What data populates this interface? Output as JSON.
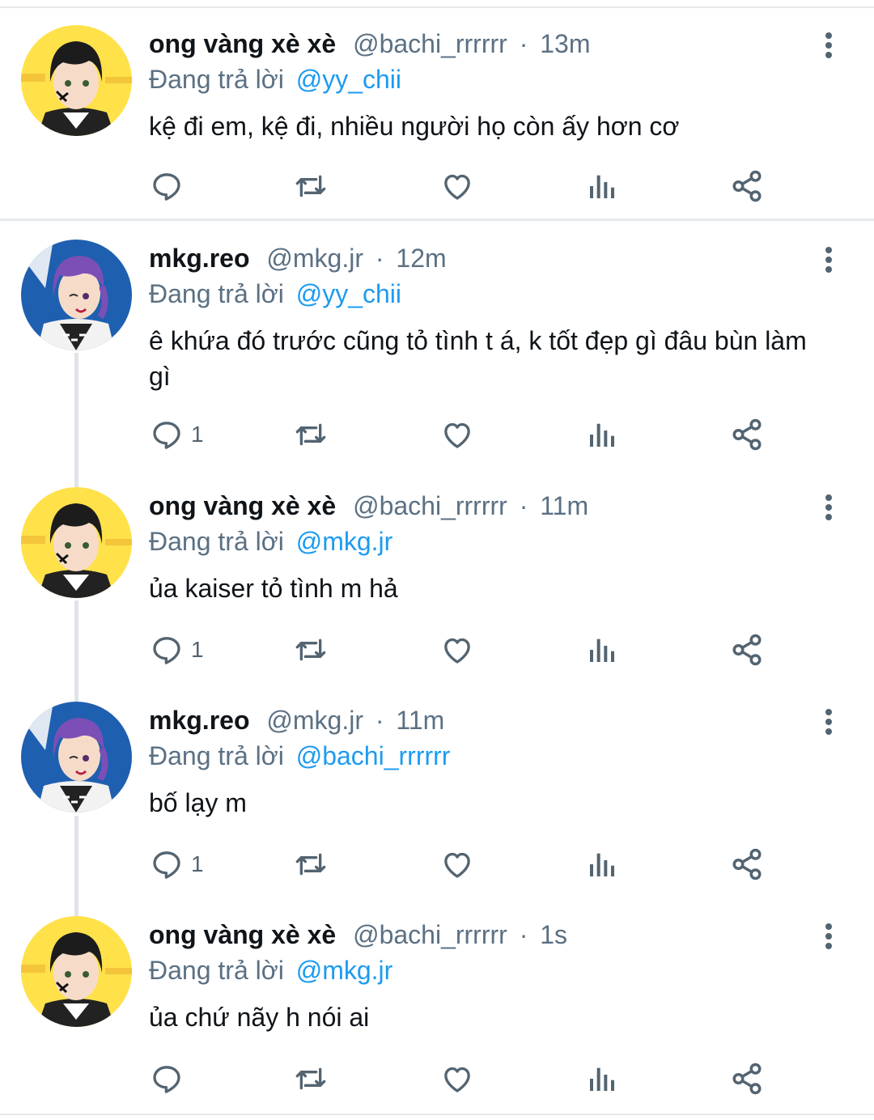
{
  "tweets": [
    {
      "name": "ong vàng xè xè",
      "handle": "@bachi_rrrrrr",
      "separator": "·",
      "time": "13m",
      "replying_label": "Đang trả lời",
      "replying_to": "@yy_chii",
      "text": "kệ đi em, kệ đi, nhiều người họ còn ấy hơn cơ",
      "reply_count": "",
      "avatar": "yellow-avatar"
    },
    {
      "name": "mkg.reo",
      "handle": "@mkg.jr",
      "separator": "·",
      "time": "12m",
      "replying_label": "Đang trả lời",
      "replying_to": "@yy_chii",
      "text": "ê khứa đó trước cũng tỏ tình t á, k tốt đẹp gì đâu bùn làm gì",
      "reply_count": "1",
      "avatar": "blue-avatar"
    },
    {
      "name": "ong vàng xè xè",
      "handle": "@bachi_rrrrrr",
      "separator": "·",
      "time": "11m",
      "replying_label": "Đang trả lời",
      "replying_to": "@mkg.jr",
      "text": "ủa kaiser tỏ tình m hả",
      "reply_count": "1",
      "avatar": "yellow-avatar"
    },
    {
      "name": "mkg.reo",
      "handle": "@mkg.jr",
      "separator": "·",
      "time": "11m",
      "replying_label": "Đang trả lời",
      "replying_to": "@bachi_rrrrrr",
      "text": "bố lạy m",
      "reply_count": "1",
      "avatar": "blue-avatar"
    },
    {
      "name": "ong vàng xè xè",
      "handle": "@bachi_rrrrrr",
      "separator": "·",
      "time": "1s",
      "replying_label": "Đang trả lời",
      "replying_to": "@mkg.jr",
      "text": "ủa chứ nãy h nói ai",
      "reply_count": "",
      "avatar": "yellow-avatar"
    }
  ],
  "icons": {
    "reply": "reply-icon",
    "retweet": "retweet-icon",
    "like": "like-icon",
    "views": "views-icon",
    "share": "share-icon",
    "more": "more-icon"
  },
  "colors": {
    "mention": "#1d9bf0",
    "secondary_text": "#5b7083",
    "icon": "#536471",
    "divider": "#e6e9ec",
    "yellow_avatar_bg": "#ffe14a",
    "blue_avatar_bg": "#1f5fb0"
  }
}
